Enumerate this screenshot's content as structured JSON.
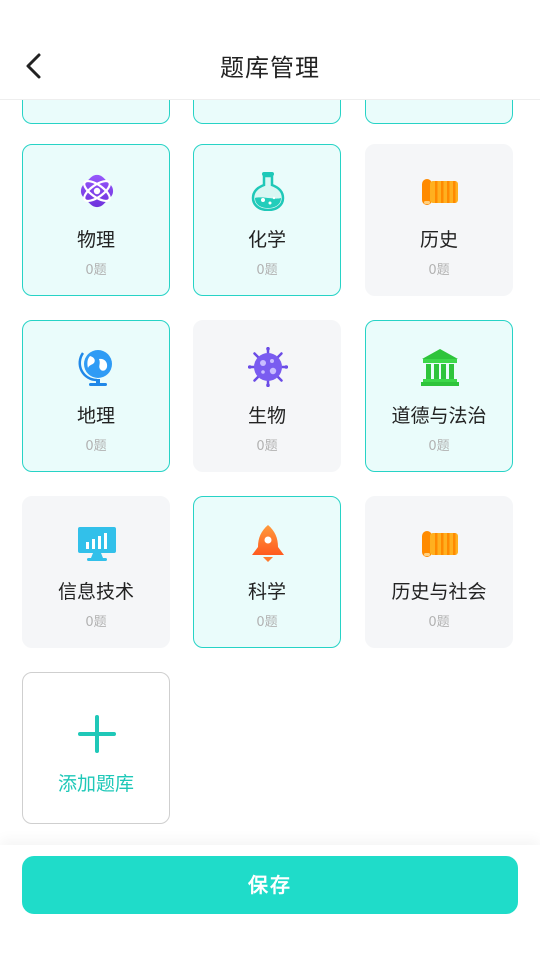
{
  "header": {
    "title": "题库管理",
    "back_icon": "chevron-left-icon"
  },
  "subjects": [
    {
      "name": "物理",
      "count": "0题",
      "selected": true,
      "icon": "atom-icon"
    },
    {
      "name": "化学",
      "count": "0题",
      "selected": true,
      "icon": "flask-icon"
    },
    {
      "name": "历史",
      "count": "0题",
      "selected": false,
      "icon": "scroll-icon"
    },
    {
      "name": "地理",
      "count": "0题",
      "selected": true,
      "icon": "globe-icon"
    },
    {
      "name": "生物",
      "count": "0题",
      "selected": false,
      "icon": "microbe-icon"
    },
    {
      "name": "道德与法治",
      "count": "0题",
      "selected": true,
      "icon": "courthouse-icon"
    },
    {
      "name": "信息技术",
      "count": "0题",
      "selected": false,
      "icon": "monitor-chart-icon"
    },
    {
      "name": "科学",
      "count": "0题",
      "selected": true,
      "icon": "rocket-icon"
    },
    {
      "name": "历史与社会",
      "count": "0题",
      "selected": false,
      "icon": "scroll-icon"
    }
  ],
  "add_card": {
    "label": "添加题库",
    "icon": "plus-icon"
  },
  "footer": {
    "save_label": "保存"
  },
  "colors": {
    "accent": "#1fdcc9",
    "accent_text": "#1fc8b8",
    "selected_bg": "#eafcfb",
    "selected_border": "#27d3c6",
    "unselected_bg": "#f5f6f8"
  }
}
